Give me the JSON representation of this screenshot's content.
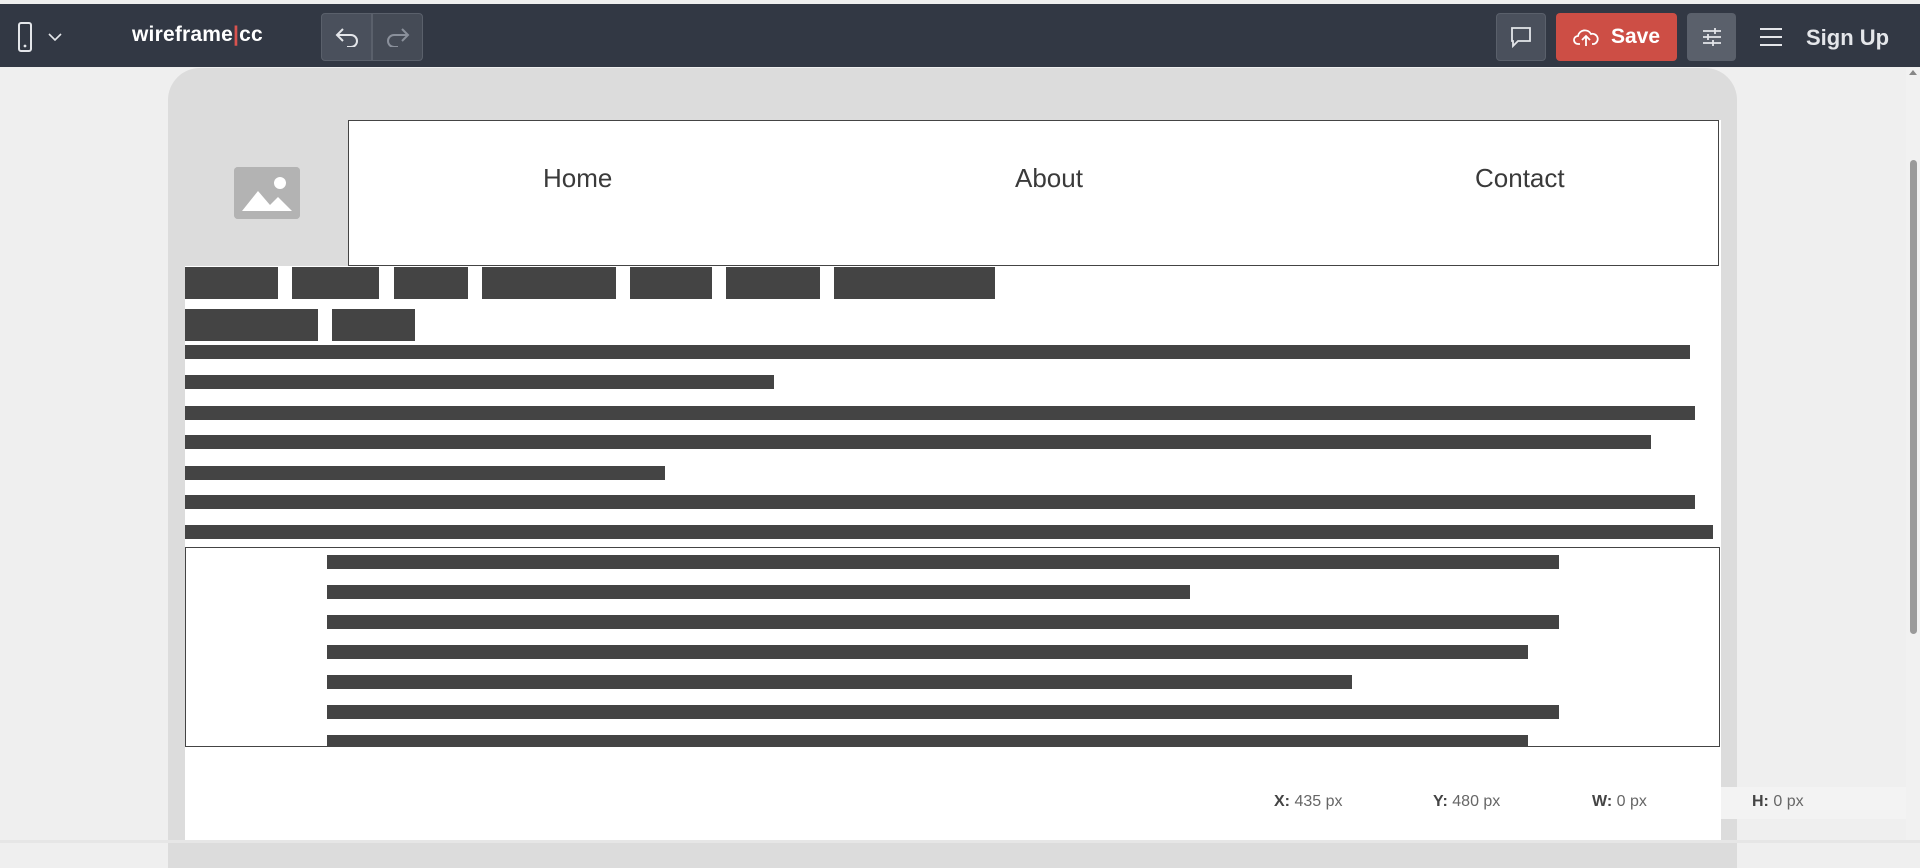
{
  "toolbar": {
    "device_icon": "mobile-phone-icon",
    "logo_main": "wireframe",
    "logo_sep": "|",
    "logo_tld": "cc",
    "undo_icon": "undo-icon",
    "redo_icon": "redo-icon",
    "comment_icon": "comment-icon",
    "save_label": "Save",
    "save_icon": "cloud-upload-icon",
    "settings_icon": "sliders-icon",
    "menu_icon": "hamburger-menu-icon",
    "signup_label": "Sign Up"
  },
  "nav": {
    "items": [
      {
        "label": "Home"
      },
      {
        "label": "About"
      },
      {
        "label": "Contact"
      }
    ]
  },
  "status": {
    "x_label": "X:",
    "x_value": "435 px",
    "y_label": "Y:",
    "y_value": "480 px",
    "w_label": "W:",
    "w_value": "0 px",
    "h_label": "H:",
    "h_value": "0 px"
  },
  "colors": {
    "toolbar_bg": "#323844",
    "save_bg": "#cd4e45",
    "block": "#444444"
  }
}
